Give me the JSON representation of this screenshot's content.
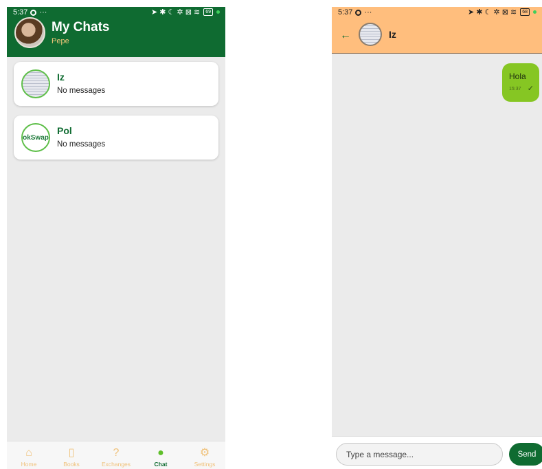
{
  "left_screen": {
    "status": {
      "time": "5:37",
      "extra": "···",
      "icons": "➤ ✱ ☾ ✲ ⊠ ≋",
      "battery": "69"
    },
    "header": {
      "title": "My Chats",
      "subtitle": "Pepe"
    },
    "chats": [
      {
        "name": "Iz",
        "preview": "No messages"
      },
      {
        "name": "Pol",
        "preview": "No messages",
        "logo_text": "okSwap"
      }
    ],
    "nav": [
      {
        "label": "Home",
        "icon": "⌂"
      },
      {
        "label": "Books",
        "icon": "▯"
      },
      {
        "label": "Exchanges",
        "icon": "?"
      },
      {
        "label": "Chat",
        "icon": "●",
        "active": true
      },
      {
        "label": "Settings",
        "icon": "⚙"
      }
    ]
  },
  "right_screen": {
    "status": {
      "time": "5:37",
      "extra": "···",
      "icons": "➤ ✱ ☾ ✲ ⊠ ≋",
      "battery": "68"
    },
    "header": {
      "back": "←",
      "contact_name": "Iz"
    },
    "messages": [
      {
        "text": "Hola",
        "time": "15:37",
        "status": "✓"
      }
    ],
    "composer": {
      "placeholder": "Type a message...",
      "send_label": "Send"
    }
  },
  "colors": {
    "primary_green": "#0f6b31",
    "accent_orange": "#ffbe7d",
    "bubble_green": "#86c623",
    "nav_inactive": "#f0c27b",
    "background": "#ebebeb"
  }
}
